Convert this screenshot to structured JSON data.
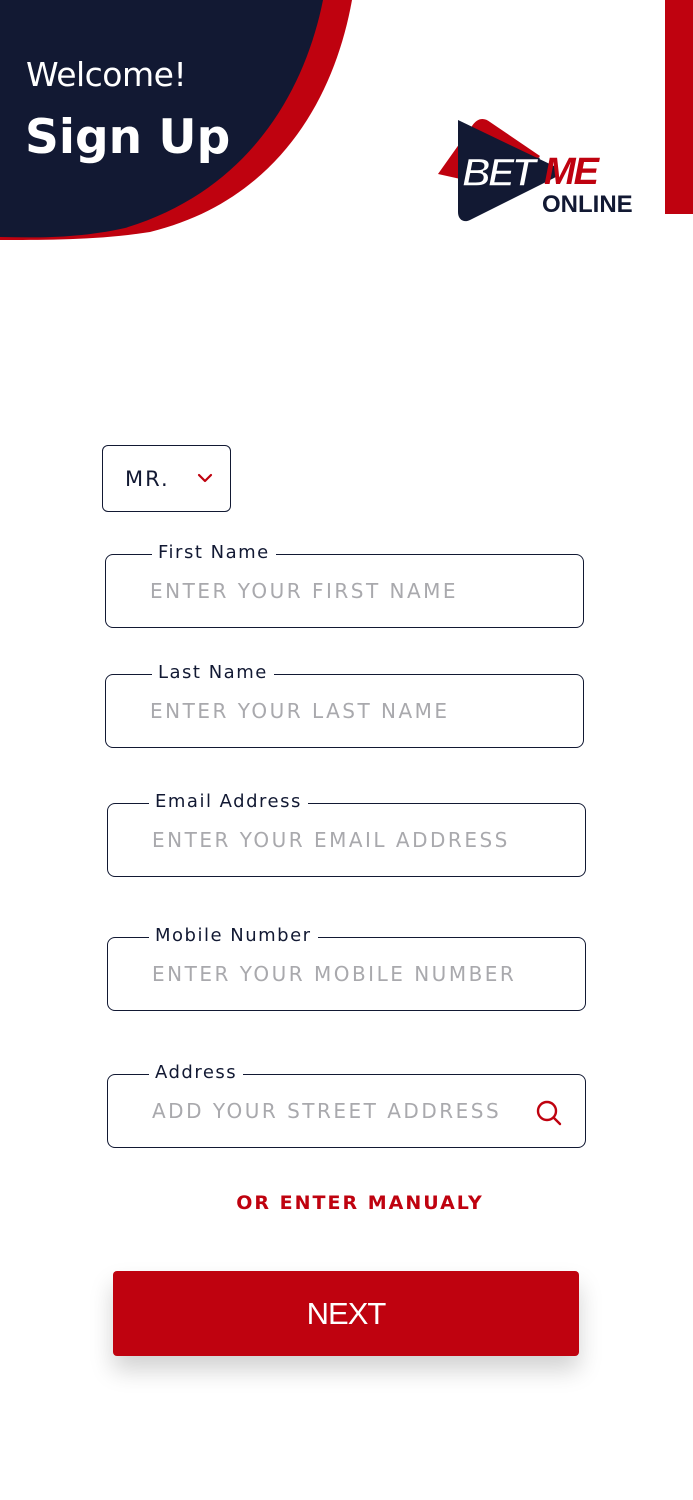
{
  "header": {
    "welcome": "Welcome!",
    "title": "Sign Up",
    "colors": {
      "navy": "#121933",
      "red": "#bf020f"
    }
  },
  "logo": {
    "line1": "BETME",
    "line2": "ONLINE"
  },
  "title_select": {
    "value": "MR.",
    "icon": "chevron-down-icon"
  },
  "fields": {
    "first_name": {
      "label": "First Name",
      "placeholder": "ENTER YOUR FIRST NAME",
      "value": ""
    },
    "last_name": {
      "label": "Last Name",
      "placeholder": "ENTER YOUR LAST NAME",
      "value": ""
    },
    "email": {
      "label": "Email Address",
      "placeholder": "ENTER YOUR EMAIL ADDRESS",
      "value": ""
    },
    "mobile": {
      "label": "Mobile Number",
      "placeholder": "ENTER YOUR MOBILE NUMBER",
      "value": ""
    },
    "address": {
      "label": "Address",
      "placeholder": "ADD YOUR STREET ADDRESS",
      "value": "",
      "icon": "search-icon"
    }
  },
  "manual_link": "OR ENTER MANUALY",
  "next_button": "NEXT"
}
